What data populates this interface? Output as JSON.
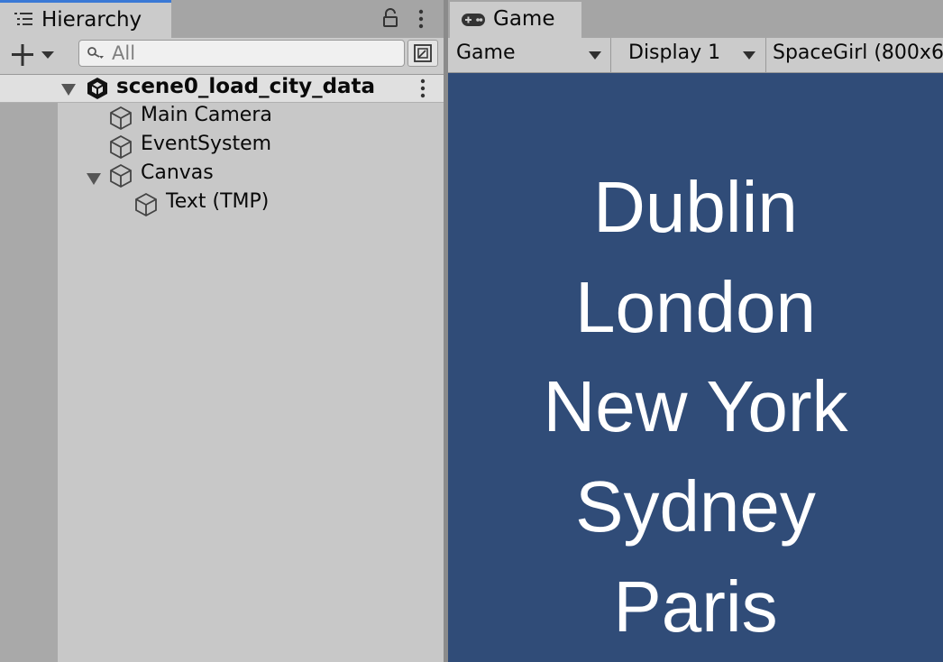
{
  "hierarchy": {
    "tab_label": "Hierarchy",
    "search_placeholder": "All",
    "scene_name": "scene0_load_city_data",
    "objects": [
      {
        "label": "Main Camera"
      },
      {
        "label": "EventSystem"
      },
      {
        "label": "Canvas",
        "expanded": true
      },
      {
        "label": "Text (TMP)"
      }
    ]
  },
  "game": {
    "tab_label": "Game",
    "view_dropdown": "Game",
    "display_dropdown": "Display 1",
    "resolution_dropdown": "SpaceGirl (800x6",
    "viewport_bg": "#304c78",
    "cities": [
      "Dublin",
      "London",
      "New York",
      "Sydney",
      "Paris"
    ]
  },
  "colors": {
    "accent": "#3a79d6",
    "panel": "#c8c8c8"
  }
}
